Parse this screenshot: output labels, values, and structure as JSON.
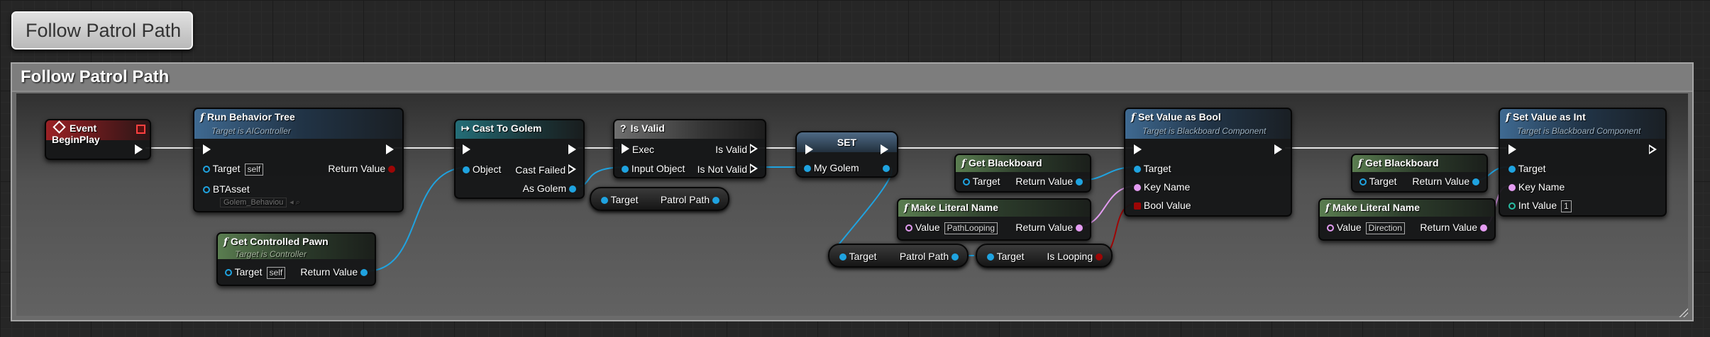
{
  "tab_title": "Follow Patrol Path",
  "comment_title": "Follow Patrol Path",
  "nodes": {
    "event_begin": {
      "title": "Event BeginPlay"
    },
    "run_bt": {
      "title": "Run Behavior Tree",
      "subtitle": "Target is AIController",
      "target_label": "Target",
      "target_value": "self",
      "return_label": "Return Value",
      "btasset_label": "BTAsset",
      "btasset_value": "Golem_Behaviou"
    },
    "get_pawn": {
      "title": "Get Controlled Pawn",
      "subtitle": "Target is Controller",
      "target_label": "Target",
      "target_value": "self",
      "return_label": "Return Value"
    },
    "cast": {
      "title": "Cast To Golem",
      "object_label": "Object",
      "cast_failed_label": "Cast Failed",
      "as_label": "As Golem"
    },
    "is_valid": {
      "title": "Is Valid",
      "exec_label": "Exec",
      "input_label": "Input Object",
      "valid_label": "Is Valid",
      "not_valid_label": "Is Not Valid"
    },
    "patrol_path_1": {
      "target_label": "Target",
      "value_label": "Patrol Path"
    },
    "set": {
      "title": "SET",
      "var_label": "My Golem"
    },
    "get_bb_1": {
      "title": "Get Blackboard",
      "target_label": "Target",
      "return_label": "Return Value"
    },
    "make_name_1": {
      "title": "Make Literal Name",
      "value_label": "Value",
      "value": "PathLooping",
      "return_label": "Return Value"
    },
    "patrol_path_2": {
      "target_label": "Target",
      "value_label": "Patrol Path"
    },
    "is_looping": {
      "target_label": "Target",
      "value_label": "Is Looping"
    },
    "set_bool": {
      "title": "Set Value as Bool",
      "subtitle": "Target is Blackboard Component",
      "target_label": "Target",
      "key_label": "Key Name",
      "bool_label": "Bool Value"
    },
    "get_bb_2": {
      "title": "Get Blackboard",
      "target_label": "Target",
      "return_label": "Return Value"
    },
    "make_name_2": {
      "title": "Make Literal Name",
      "value_label": "Value",
      "value": "Direction",
      "return_label": "Return Value"
    },
    "set_int": {
      "title": "Set Value as Int",
      "subtitle": "Target is Blackboard Component",
      "target_label": "Target",
      "key_label": "Key Name",
      "int_label": "Int Value",
      "int_value": "1"
    }
  },
  "colors": {
    "exec": "#ffffff",
    "object": "#1fa3e0",
    "name": "#e49cf2",
    "bool": "#9d0606",
    "int": "#28bca3"
  }
}
